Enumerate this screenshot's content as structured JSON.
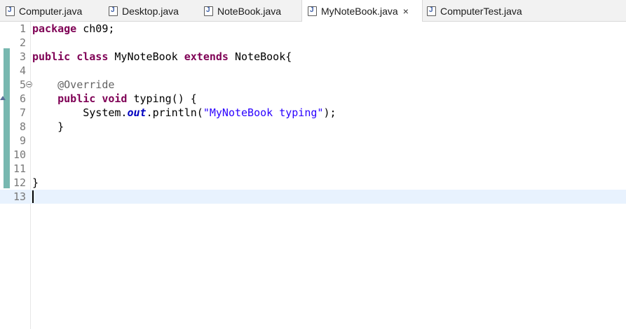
{
  "tabs": [
    {
      "label": "Computer.java",
      "active": false
    },
    {
      "label": "Desktop.java",
      "active": false
    },
    {
      "label": "NoteBook.java",
      "active": false
    },
    {
      "label": "MyNoteBook.java",
      "active": true,
      "close": "×"
    },
    {
      "label": "ComputerTest.java",
      "active": false
    }
  ],
  "editor": {
    "file": "MyNoteBook.java",
    "current_line": 13,
    "lines": [
      {
        "n": "1",
        "t": [
          "package",
          " ch09;"
        ]
      },
      {
        "n": "2",
        "t": []
      },
      {
        "n": "3",
        "t": [
          "public",
          " ",
          "class",
          " MyNoteBook ",
          "extends",
          " NoteBook{"
        ]
      },
      {
        "n": "4",
        "t": []
      },
      {
        "n": "5",
        "t": [
          "    ",
          "@Override"
        ]
      },
      {
        "n": "6",
        "t": [
          "    ",
          "public",
          " ",
          "void",
          " typing() {"
        ]
      },
      {
        "n": "7",
        "t": [
          "        System.",
          "out",
          ".println(",
          "\"MyNoteBook typing\"",
          ");"
        ]
      },
      {
        "n": "8",
        "t": [
          "    }"
        ]
      },
      {
        "n": "9",
        "t": []
      },
      {
        "n": "10",
        "t": []
      },
      {
        "n": "11",
        "t": []
      },
      {
        "n": "12",
        "t": [
          "}"
        ]
      },
      {
        "n": "13",
        "t": []
      }
    ]
  },
  "icons": {
    "file": "java-file-icon",
    "close": "close-icon",
    "fold": "fold-collapse-icon",
    "override": "override-marker-icon"
  },
  "colors": {
    "keyword": "#7f0055",
    "annotation": "#646464",
    "string": "#2a00ff",
    "static_field": "#0000c0",
    "current_line": "#e8f2fe",
    "quick_diff": "#78b8b0"
  }
}
